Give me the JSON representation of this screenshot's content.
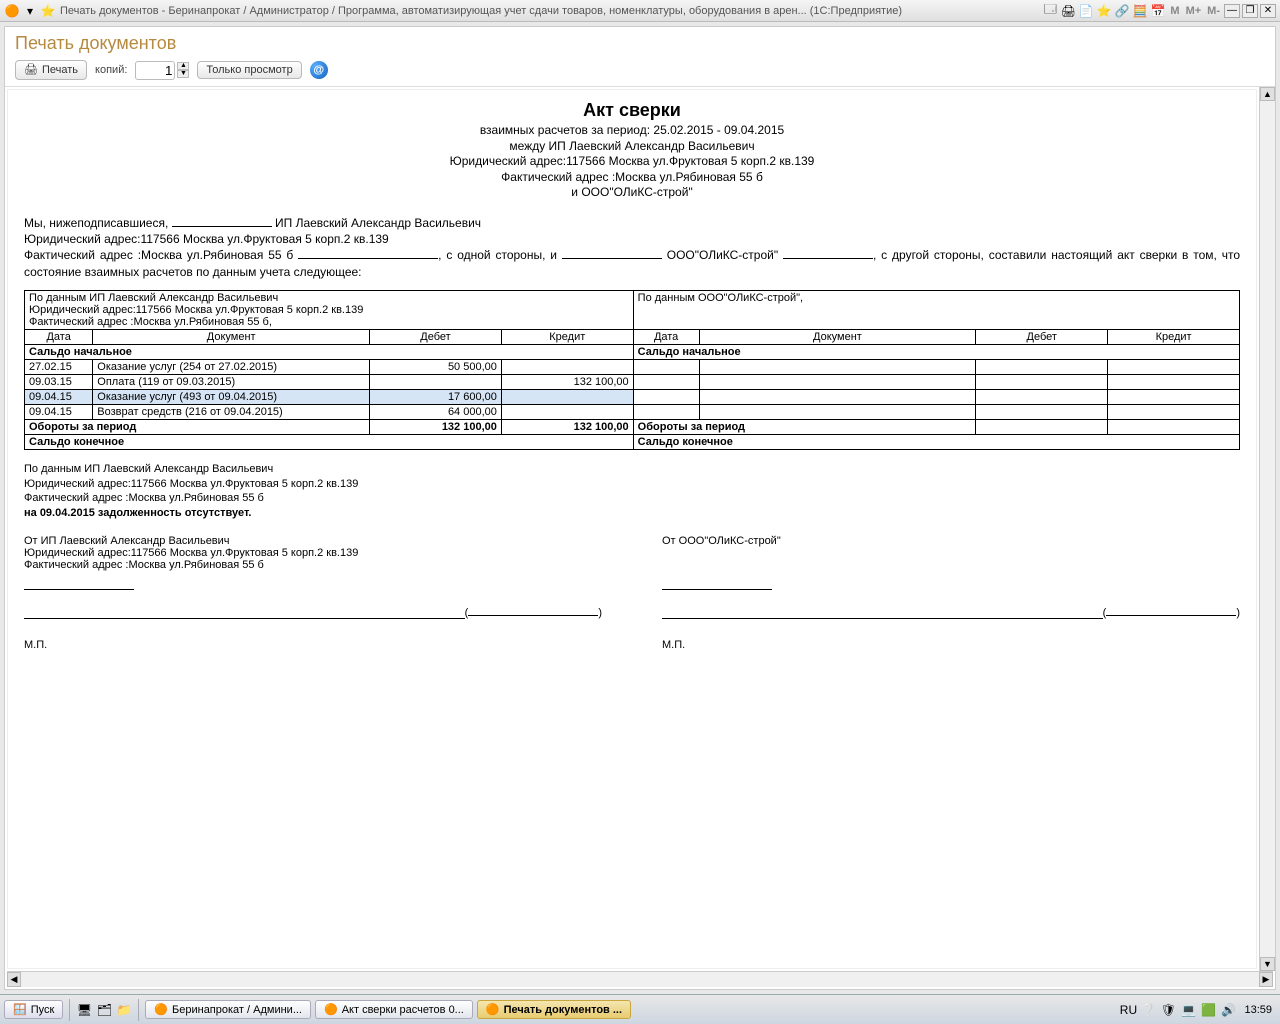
{
  "titleBar": {
    "title": "Печать документов - Беринапрокат / Администратор / Программа, автоматизирующая учет сдачи товаров, номенклатуры, оборудования в арен... (1С:Предприятие)",
    "mButtons": [
      "M",
      "M+",
      "M-"
    ]
  },
  "page": {
    "header": "Печать документов",
    "toolbar": {
      "print": "Печать",
      "copiesLabel": "копий:",
      "copiesValue": "1",
      "viewOnly": "Только просмотр"
    }
  },
  "doc": {
    "title": "Акт сверки",
    "l1": "взаимных расчетов за период: 25.02.2015 - 09.04.2015",
    "l2": "между ИП Лаевский Александр Васильевич",
    "l3": "Юридический адрес:117566 Москва ул.Фруктовая 5 корп.2 кв.139",
    "l4": "Фактический адрес :Москва ул.Рябиновая 55 б",
    "l5": "и ООО\"ОЛиКС-строй\"",
    "para1a": "Мы, нижеподписавшиеся, ",
    "para1b": " ИП Лаевский Александр Васильевич",
    "para2": "Юридический адрес:117566 Москва ул.Фруктовая 5 корп.2 кв.139",
    "para3a": "Фактический адрес :Москва ул.Рябиновая 55 б ",
    "para3b": ", с одной стороны, и ",
    "para3c": " ООО\"ОЛиКС-строй\" ",
    "para3d": ", с другой стороны, составили настоящий акт сверки в том, что состояние взаимных расчетов по данным учета следующее:"
  },
  "table": {
    "topLeft1": "По данным ИП Лаевский Александр Васильевич",
    "topLeft2": "Юридический адрес:117566 Москва ул.Фруктовая 5 корп.2 кв.139",
    "topLeft3": "Фактический адрес :Москва ул.Рябиновая 55 б,",
    "topRight": "По данным ООО\"ОЛиКС-строй\",",
    "hDate": "Дата",
    "hDoc": "Документ",
    "hDebit": "Дебет",
    "hCredit": "Кредит",
    "openBal": "Сальдо начальное",
    "rows": [
      {
        "d": "27.02.15",
        "doc": "Оказание услуг (254 от 27.02.2015)",
        "debit": "50 500,00",
        "credit": ""
      },
      {
        "d": "09.03.15",
        "doc": "Оплата (119 от 09.03.2015)",
        "debit": "",
        "credit": "132 100,00"
      },
      {
        "d": "09.04.15",
        "doc": "Оказание услуг (493 от 09.04.2015)",
        "debit": "17 600,00",
        "credit": ""
      },
      {
        "d": "09.04.15",
        "doc": "Возврат средств (216 от 09.04.2015)",
        "debit": "64 000,00",
        "credit": ""
      }
    ],
    "turnoverLabel": "Обороты за период",
    "turnoverDebit": "132 100,00",
    "turnoverCredit": "132 100,00",
    "closeBal": "Сальдо конечное"
  },
  "footer": {
    "b1l1": "По данным ИП Лаевский Александр Васильевич",
    "b1l2": "Юридический адрес:117566 Москва ул.Фруктовая 5 корп.2 кв.139",
    "b1l3": "Фактический адрес :Москва ул.Рябиновая 55 б",
    "b1l4": "на 09.04.2015 задолженность отсутствует.",
    "sigLeft1": "От ИП Лаевский Александр Васильевич",
    "sigLeft2": "Юридический адрес:117566 Москва ул.Фруктовая 5 корп.2 кв.139",
    "sigLeft3": "Фактический адрес :Москва ул.Рябиновая 55 б",
    "sigRight1": "От ООО\"ОЛиКС-строй\"",
    "mp": "М.П."
  },
  "taskbar": {
    "start": "Пуск",
    "items": [
      "Беринапрокат / Админи...",
      "Акт сверки расчетов 0...",
      "Печать документов ..."
    ],
    "lang": "RU",
    "clock": "13:59"
  }
}
